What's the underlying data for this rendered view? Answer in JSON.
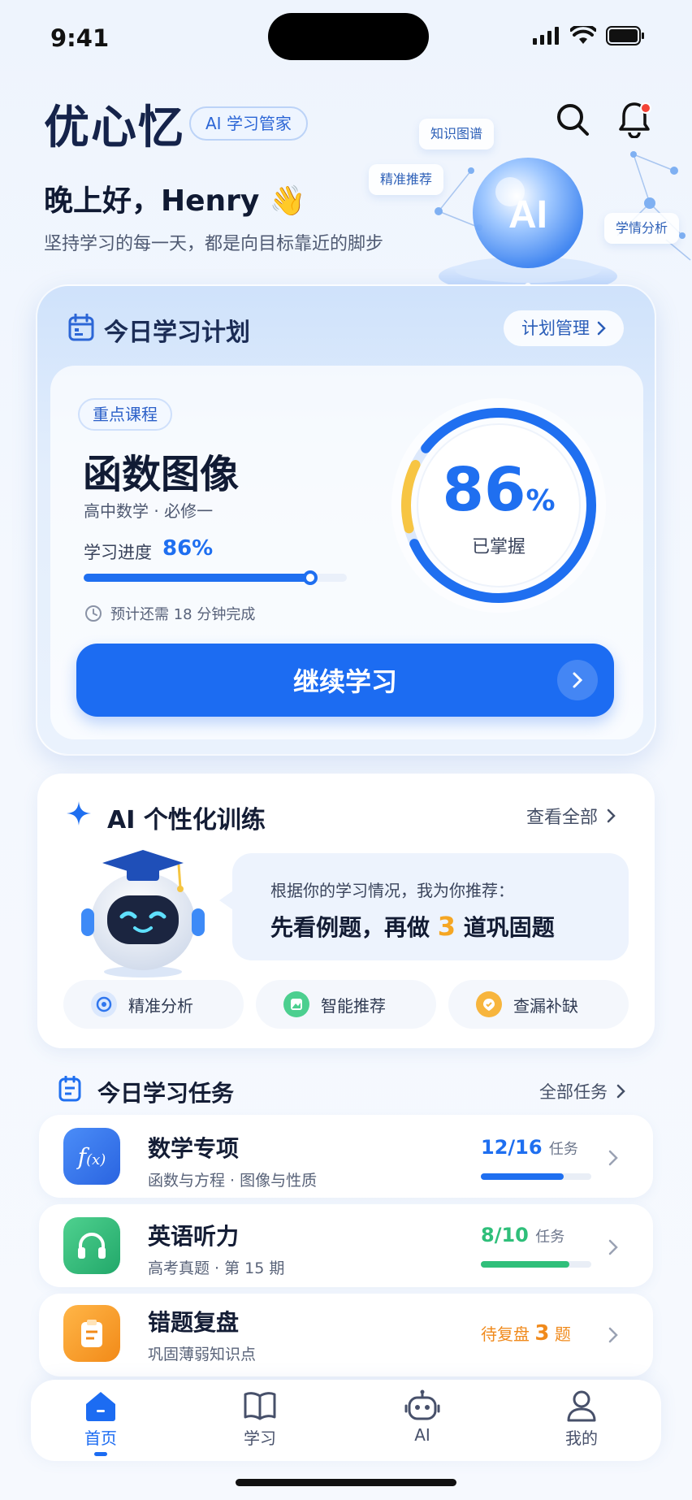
{
  "status_bar": {
    "time": "9:41"
  },
  "header": {
    "brand": "优心忆",
    "badge": "AI 学习管家",
    "greeting": "晚上好，Henry 👋",
    "subline": "坚持学习的每一天，都是向目标靠近的脚步",
    "orb_label": "AI",
    "orb_tags": [
      "知识图谱",
      "精准推荐",
      "学情分析"
    ]
  },
  "plan": {
    "title": "今日学习计划",
    "manage_label": "计划管理",
    "tag": "重点课程",
    "course_title": "函数图像",
    "course_sub": "高中数学 · 必修一",
    "progress_label": "学习进度",
    "progress_value": "86%",
    "progress_fraction": 0.86,
    "eta": "预计还需 18 分钟完成",
    "mastery_value": "86",
    "mastery_unit": "%",
    "mastery_caption": "已掌握",
    "continue_label": "继续学习"
  },
  "ai_training": {
    "title": "AI 个性化训练",
    "view_all": "查看全部",
    "bubble_line1": "根据你的学习情况，我为你推荐：",
    "bubble_line2_a": "先看例题，再做",
    "bubble_line2_num": "3",
    "bubble_line2_b": "道巩固题",
    "chips": [
      "精准分析",
      "智能推荐",
      "查漏补缺"
    ]
  },
  "tasks": {
    "title": "今日学习任务",
    "view_all": "全部任务",
    "items": [
      {
        "name": "数学专项",
        "sub": "函数与方程 · 图像与性质",
        "count": "12/16",
        "unit": "任务",
        "fraction": 0.75,
        "color": "#1f6ff0",
        "icon": "function-icon"
      },
      {
        "name": "英语听力",
        "sub": "高考真题 · 第 15 期",
        "count": "8/10",
        "unit": "任务",
        "fraction": 0.8,
        "color": "#2fbf7a",
        "icon": "headphones-icon"
      },
      {
        "name": "错题复盘",
        "sub": "巩固薄弱知识点",
        "pending_pre": "待复盘",
        "pending_num": "3",
        "pending_post": "题",
        "color": "#f08a1c",
        "icon": "clipboard-icon"
      }
    ]
  },
  "tabbar": {
    "items": [
      {
        "label": "首页",
        "icon": "home-icon",
        "active": true
      },
      {
        "label": "学习",
        "icon": "book-icon",
        "active": false
      },
      {
        "label": "AI",
        "icon": "robot-icon",
        "active": false
      },
      {
        "label": "我的",
        "icon": "profile-icon",
        "active": false
      }
    ]
  }
}
